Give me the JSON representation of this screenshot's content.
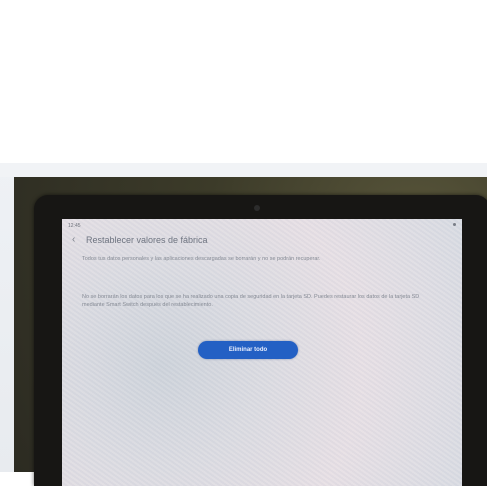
{
  "screen": {
    "status_time": "12:45",
    "title": "Restablecer valores de fábrica",
    "paragraph_1": "Todos tus datos personales y las aplicaciones descargadas se borrarán y no se podrán recuperar.",
    "paragraph_2": "No se borrarán los datos para los que se ha realizado una copia de seguridad en la tarjeta SD. Puedes restaurar los datos de la tarjeta SD mediante Smart Switch después del restablecimiento.",
    "button_label": "Eliminar todo"
  },
  "colors": {
    "button": "#2360c4",
    "tablet_bezel": "#171614",
    "background": "#ffffff"
  },
  "icons": {
    "back": "chevron-left"
  }
}
